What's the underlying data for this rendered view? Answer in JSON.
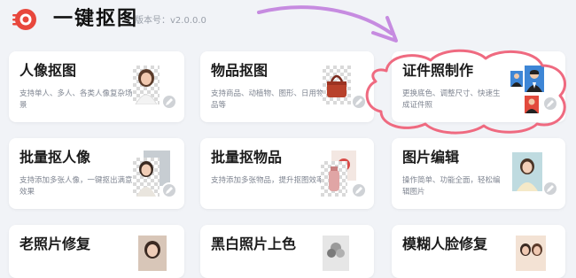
{
  "header": {
    "app_title": "一键抠图",
    "version": "版本号：v2.0.0.0"
  },
  "colors": {
    "brand_red": "#e8473c",
    "arrow_purple": "#c68be0",
    "highlight_pink": "#ef6a80"
  },
  "cards": [
    {
      "title": "人像抠图",
      "desc": "支持单人、多人、各类人像复杂场景",
      "thumb": "portrait-cutout-thumbnail"
    },
    {
      "title": "物品抠图",
      "desc": "支持商品、动植物、图形、日用物品等",
      "thumb": "red-handbag-thumbnail"
    },
    {
      "title": "证件照制作",
      "desc": "更换底色、调整尺寸、快速生成证件照",
      "thumb": "id-photo-thumbnail"
    },
    {
      "title": "批量抠人像",
      "desc": "支持添加多张人像，一键抠出满意效果",
      "thumb": "portrait-batch-thumbnail"
    },
    {
      "title": "批量抠物品",
      "desc": "支持添加多张物品，提升抠图效率",
      "thumb": "object-batch-thumbnail"
    },
    {
      "title": "图片编辑",
      "desc": "操作简单、功能全面，轻松编辑图片",
      "thumb": "photo-edit-thumbnail"
    },
    {
      "title": "老照片修复",
      "desc": "",
      "thumb": "old-photo-thumbnail"
    },
    {
      "title": "黑白照片上色",
      "desc": "",
      "thumb": "bw-colorize-thumbnail"
    },
    {
      "title": "模糊人脸修复",
      "desc": "",
      "thumb": "blurry-face-thumbnail"
    }
  ]
}
